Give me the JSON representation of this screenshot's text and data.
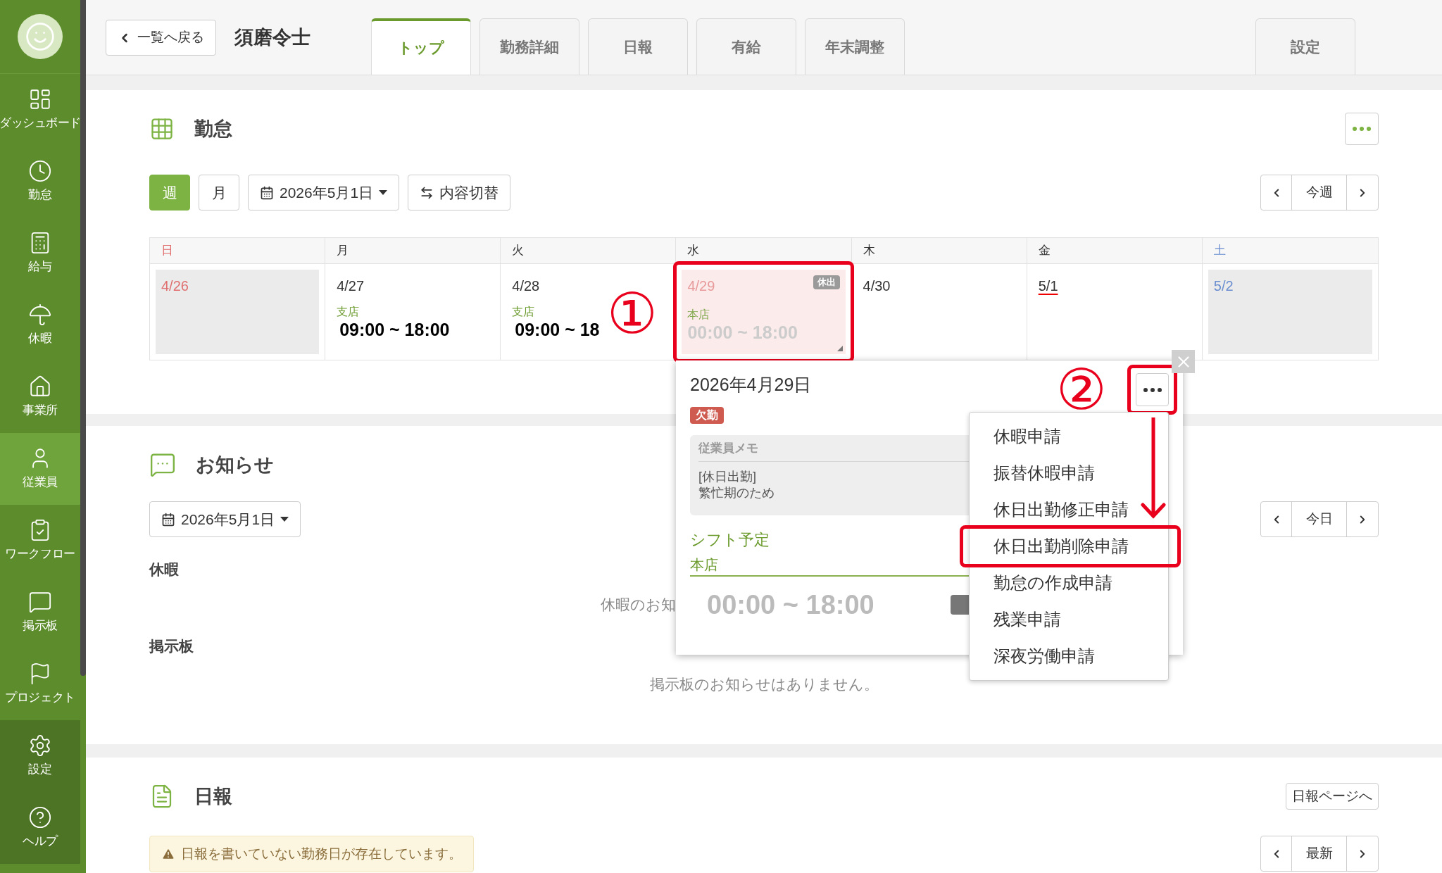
{
  "sidebar": {
    "items": [
      {
        "label": "ダッシュボード",
        "selected": false
      },
      {
        "label": "勤怠",
        "selected": false
      },
      {
        "label": "給与",
        "selected": false
      },
      {
        "label": "休暇",
        "selected": false
      },
      {
        "label": "事業所",
        "selected": false
      },
      {
        "label": "従業員",
        "selected": true
      },
      {
        "label": "ワークフロー",
        "selected": false
      },
      {
        "label": "掲示板",
        "selected": false
      },
      {
        "label": "プロジェクト",
        "selected": false
      }
    ],
    "footer_items": [
      {
        "label": "設定"
      },
      {
        "label": "ヘルプ"
      }
    ]
  },
  "header": {
    "back_button": "一覧へ戻る",
    "employee_name": "須磨令士",
    "tabs": [
      {
        "label": "トップ",
        "selected": true
      },
      {
        "label": "勤務詳細",
        "selected": false
      },
      {
        "label": "日報",
        "selected": false
      },
      {
        "label": "有給",
        "selected": false
      },
      {
        "label": "年末調整",
        "selected": false
      }
    ],
    "settings_tab": {
      "label": "設定",
      "selected": false
    }
  },
  "attendance": {
    "title": "勤怠",
    "view_buttons": [
      {
        "label": "週",
        "selected": true
      },
      {
        "label": "月",
        "selected": false
      }
    ],
    "date_picker": "2026年5月1日",
    "toggle_button": "内容切替",
    "nav_label": "今週",
    "callout": "①",
    "calendar": {
      "weekdays": [
        {
          "label": "日",
          "kind": "sunday"
        },
        {
          "label": "月",
          "kind": "weekday"
        },
        {
          "label": "火",
          "kind": "weekday"
        },
        {
          "label": "水",
          "kind": "weekday"
        },
        {
          "label": "木",
          "kind": "weekday"
        },
        {
          "label": "金",
          "kind": "weekday"
        },
        {
          "label": "土",
          "kind": "saturday"
        }
      ],
      "days": [
        {
          "date": "4/26",
          "kind": "sunday",
          "today": false,
          "annotated": false
        },
        {
          "date": "4/27",
          "kind": "shift",
          "location": "支店",
          "time": "09:00 ~ 18:00",
          "today": false,
          "annotated": false
        },
        {
          "date": "4/28",
          "kind": "shift",
          "location": "支店",
          "time": "09:00 ~ 18",
          "today": false,
          "annotated": false
        },
        {
          "date": "4/29",
          "kind": "holiday_work",
          "badge": "休出",
          "location": "本店",
          "time": "00:00 ~ 18:00",
          "today": false,
          "annotated": true
        },
        {
          "date": "4/30",
          "kind": "plain",
          "today": false,
          "annotated": false
        },
        {
          "date": "5/1",
          "kind": "plain",
          "today": true,
          "annotated": false
        },
        {
          "date": "5/2",
          "kind": "saturday",
          "today": false,
          "annotated": false
        }
      ]
    }
  },
  "popup": {
    "date": "2026年4月29日",
    "status_badge": "欠勤",
    "memo_title": "従業員メモ",
    "memo_lines": [
      "[休日出勤]",
      "繁忙期のため"
    ],
    "shift_title": "シフト予定",
    "shift_location": "本店",
    "shift_time": "00:00 ~ 18:00",
    "callout": "②",
    "menu_button_annotated": true,
    "menu": [
      {
        "label": "休暇申請",
        "annotated": false
      },
      {
        "label": "振替休暇申請",
        "annotated": false
      },
      {
        "label": "休日出勤修正申請",
        "annotated": false
      },
      {
        "label": "休日出勤削除申請",
        "annotated": true
      },
      {
        "label": "勤怠の作成申請",
        "annotated": false
      },
      {
        "label": "残業申請",
        "annotated": false
      },
      {
        "label": "深夜労働申請",
        "annotated": false
      }
    ]
  },
  "notices": {
    "title": "お知らせ",
    "date_picker": "2026年5月1日",
    "nav_label": "今日",
    "leave_heading": "休暇",
    "leave_empty": "休暇のお知",
    "board_heading": "掲示板",
    "board_empty": "掲示板のお知らせはありません。"
  },
  "daily_report": {
    "title": "日報",
    "page_button": "日報ページへ",
    "alert": "日報を書いていない勤務日が存在しています。",
    "nav_label": "最新"
  }
}
